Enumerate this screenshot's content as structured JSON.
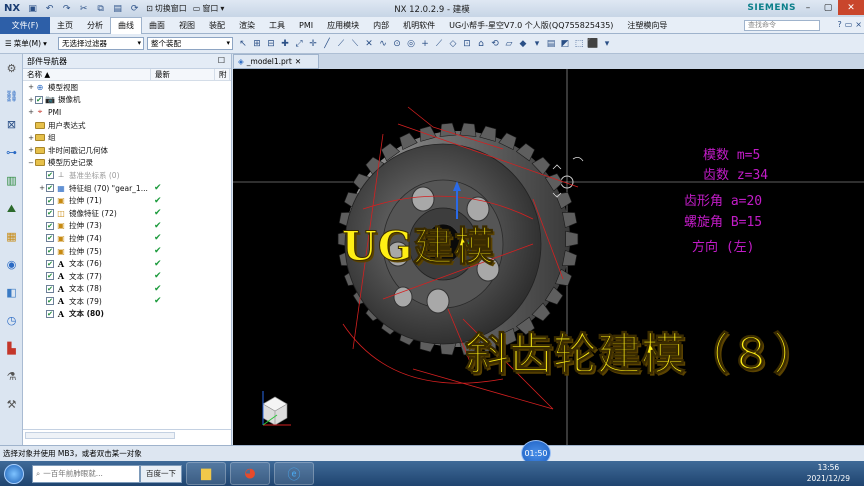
{
  "titlebar": {
    "logo": "NX",
    "switch_window": "切换窗口",
    "window_menu": "窗口",
    "title": "NX 12.0.2.9 - 建模",
    "brand": "SIEMENS"
  },
  "menubar": {
    "file": "文件(F)",
    "tabs": [
      "主页",
      "分析",
      "曲线",
      "曲面",
      "视图",
      "装配",
      "渲染",
      "工具",
      "PMI",
      "应用模块",
      "内部",
      "机明软件",
      "UG小帮手-星空V7.0 个人版(QQ755825435)",
      "注塑模向导"
    ],
    "active_tab": "曲线",
    "find_placeholder": "查找命令"
  },
  "toolbar": {
    "menu_label": "菜单(M)",
    "filter_value": "无选择过滤器",
    "assembly_value": "整个装配"
  },
  "navigator": {
    "title": "部件导航器",
    "columns": [
      "名称",
      "最新",
      "附"
    ],
    "rows": [
      {
        "label": "模型视图",
        "level": 0,
        "exp": "+",
        "icon": "views-icon",
        "check": false,
        "cb": false,
        "style": ""
      },
      {
        "label": "摄像机",
        "level": 0,
        "exp": "+",
        "icon": "camera-icon",
        "check": false,
        "cb": true,
        "style": ""
      },
      {
        "label": "PMI",
        "level": 0,
        "exp": "+",
        "icon": "pmi-icon",
        "check": false,
        "cb": false,
        "style": ""
      },
      {
        "label": "用户表达式",
        "level": 0,
        "exp": "",
        "icon": "folder-icon",
        "check": false,
        "cb": false,
        "style": ""
      },
      {
        "label": "组",
        "level": 0,
        "exp": "+",
        "icon": "folder-icon",
        "check": false,
        "cb": false,
        "style": ""
      },
      {
        "label": "非时间戳记几何体",
        "level": 0,
        "exp": "+",
        "icon": "folder-icon",
        "check": false,
        "cb": false,
        "style": ""
      },
      {
        "label": "模型历史记录",
        "level": 0,
        "exp": "−",
        "icon": "folder-icon",
        "check": false,
        "cb": false,
        "style": ""
      },
      {
        "label": "基准坐标系 (0)",
        "level": 1,
        "exp": "",
        "icon": "datum-csys-icon",
        "check": false,
        "cb": true,
        "style": "dim"
      },
      {
        "label": "特征组 (70) \"gear_1...",
        "level": 1,
        "exp": "+",
        "icon": "feature-group-icon",
        "check": true,
        "cb": true,
        "style": ""
      },
      {
        "label": "拉伸 (71)",
        "level": 1,
        "exp": "",
        "icon": "extrude-icon",
        "check": true,
        "cb": true,
        "style": ""
      },
      {
        "label": "镜像特征 (72)",
        "level": 1,
        "exp": "",
        "icon": "mirror-icon",
        "check": true,
        "cb": true,
        "style": ""
      },
      {
        "label": "拉伸 (73)",
        "level": 1,
        "exp": "",
        "icon": "extrude-icon",
        "check": true,
        "cb": true,
        "style": ""
      },
      {
        "label": "拉伸 (74)",
        "level": 1,
        "exp": "",
        "icon": "extrude-icon",
        "check": true,
        "cb": true,
        "style": ""
      },
      {
        "label": "拉伸 (75)",
        "level": 1,
        "exp": "",
        "icon": "extrude-icon",
        "check": true,
        "cb": true,
        "style": ""
      },
      {
        "label": "文本 (76)",
        "level": 1,
        "exp": "",
        "icon": "text-icon",
        "check": true,
        "cb": true,
        "style": ""
      },
      {
        "label": "文本 (77)",
        "level": 1,
        "exp": "",
        "icon": "text-icon",
        "check": true,
        "cb": true,
        "style": ""
      },
      {
        "label": "文本 (78)",
        "level": 1,
        "exp": "",
        "icon": "text-icon",
        "check": true,
        "cb": true,
        "style": ""
      },
      {
        "label": "文本 (79)",
        "level": 1,
        "exp": "",
        "icon": "text-icon",
        "check": true,
        "cb": true,
        "style": ""
      },
      {
        "label": "文本 (80)",
        "level": 1,
        "exp": "",
        "icon": "text-icon",
        "check": false,
        "cb": true,
        "style": "bold"
      }
    ]
  },
  "viewport": {
    "tab_label": "_model1.prt",
    "params": [
      "模数 m=5",
      "齿数 z=34",
      "齿形角 a=20",
      "螺旋角 B=15",
      "方向 (左)"
    ],
    "overlay_title": "UG建模",
    "overlay_subtitle": "斜齿轮建模（８）"
  },
  "statusbar": {
    "message": "选择对象并使用 MB3，或者双击某一对象",
    "video_time": "01:50"
  },
  "taskbar": {
    "search_placeholder": "一百年前肺眼就...",
    "search_button": "百度一下",
    "time": "13:56",
    "date": "2021/12/29"
  },
  "colors": {
    "param_magenta": "#c21cc7",
    "overlay_yellow": "#ffef14",
    "file_tab_blue": "#2d5fa8",
    "dimension_red": "#d42020"
  }
}
